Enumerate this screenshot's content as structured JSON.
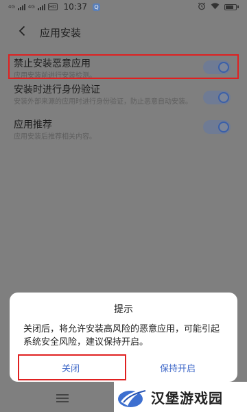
{
  "status_bar": {
    "signal1_label": "4G",
    "signal2_label": "4G",
    "hd_label": "HD",
    "time": "10:37",
    "app_badge": "Q"
  },
  "header": {
    "title": "应用安装"
  },
  "settings": [
    {
      "title": "禁止安装恶意应用",
      "desc": "应用安装前进行安装检测。",
      "enabled": true
    },
    {
      "title": "安装时进行身份验证",
      "desc": "安装外部来源的应用时进行身份验证，防止恶意自动安装。",
      "enabled": true
    },
    {
      "title": "应用推荐",
      "desc": "应用安装后推荐相关内容。",
      "enabled": true
    }
  ],
  "dialog": {
    "title": "提示",
    "message": "关闭后，将允许安装高风险的恶意应用，可能引起系统安全风险，建议保持开启。",
    "close_label": "关闭",
    "keep_label": "保持开启"
  },
  "watermark": {
    "text": "汉堡游戏园"
  },
  "colors": {
    "dim_background": "#7f7f7f",
    "accent_blue": "#3f68c8",
    "highlight_red": "#e02020"
  }
}
